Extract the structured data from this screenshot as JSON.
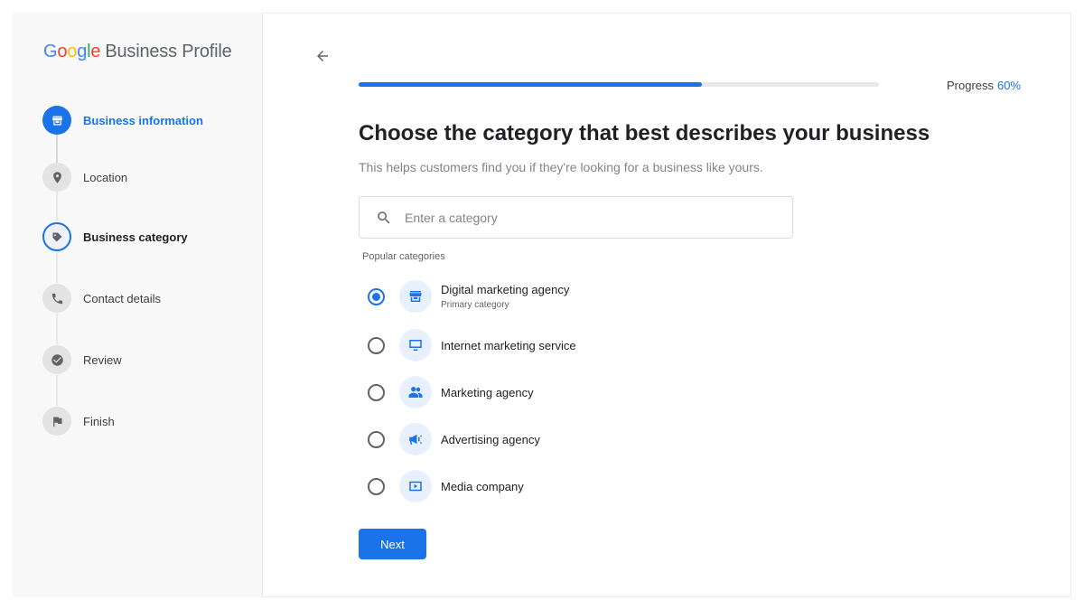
{
  "brand": {
    "google_letters": [
      "G",
      "o",
      "o",
      "g",
      "l",
      "e"
    ],
    "product": "Business Profile"
  },
  "steps": [
    {
      "label": "Business information",
      "icon": "storefront-icon",
      "state": "completed"
    },
    {
      "label": "Location",
      "icon": "location-pin-icon",
      "state": "upcoming"
    },
    {
      "label": "Business category",
      "icon": "category-tag-icon",
      "state": "current"
    },
    {
      "label": "Contact details",
      "icon": "phone-icon",
      "state": "upcoming"
    },
    {
      "label": "Review",
      "icon": "check-circle-icon",
      "state": "upcoming"
    },
    {
      "label": "Finish",
      "icon": "flag-icon",
      "state": "upcoming"
    }
  ],
  "progress": {
    "label": "Progress",
    "value_text": "60%",
    "fraction": 0.66
  },
  "main": {
    "title": "Choose the category that best describes your business",
    "subtitle": "This helps customers find you if they're looking for a business like yours.",
    "search_placeholder": "Enter a category",
    "popular_label": "Popular categories",
    "categories": [
      {
        "name": "Digital marketing agency",
        "sub": "Primary category",
        "icon": "storefront-icon",
        "selected": true
      },
      {
        "name": "Internet marketing service",
        "sub": "",
        "icon": "monitor-icon",
        "selected": false
      },
      {
        "name": "Marketing agency",
        "sub": "",
        "icon": "people-icon",
        "selected": false
      },
      {
        "name": "Advertising agency",
        "sub": "",
        "icon": "megaphone-icon",
        "selected": false
      },
      {
        "name": "Media company",
        "sub": "",
        "icon": "play-video-icon",
        "selected": false
      }
    ],
    "next_label": "Next"
  },
  "colors": {
    "accent": "#1a73e8",
    "sidebar_bg": "#f8f8f8",
    "icon_bubble": "#e8f0fe"
  }
}
